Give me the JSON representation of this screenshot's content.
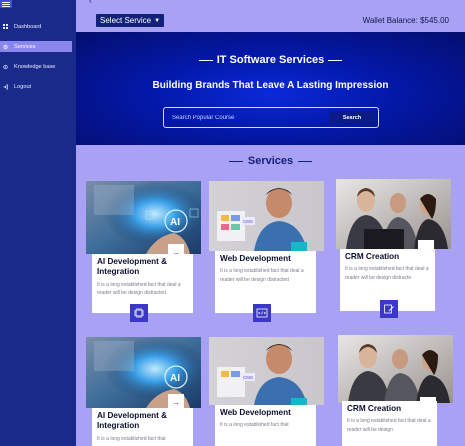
{
  "sidebar": {
    "items": [
      {
        "label": "Dashboard",
        "icon": "grid-icon"
      },
      {
        "label": "Services",
        "icon": "gear-icon",
        "active": true
      },
      {
        "label": "Knowledge base",
        "icon": "book-icon"
      },
      {
        "label": "Logout",
        "icon": "logout-icon"
      }
    ]
  },
  "topbar": {
    "select_label": "Select Service",
    "wallet_balance": "Wallet Balance: $545.00"
  },
  "hero": {
    "title": "IT Software Services",
    "subtitle": "Building Brands That Leave A Lasting Impression",
    "search_placeholder": "Search Popular Course",
    "search_button": "Search"
  },
  "services": {
    "heading": "Services",
    "cards": [
      {
        "title": "AI Development & Integration",
        "desc": "It is a long established fact that deal a reader will be design distracted"
      },
      {
        "title": "Web Development",
        "desc": "It is a long established fact that deal a reader will be design distracted"
      },
      {
        "title": "CRM Creation",
        "desc": "It is a long established fact that deal a reader will be design distracte"
      },
      {
        "title": "AI Development & Integration",
        "desc": "It is a long established fact that"
      },
      {
        "title": "Web Development",
        "desc": "It is a long established fact that"
      },
      {
        "title": "CRM Creation",
        "desc": "It is a long established fact that deal a reader will be design"
      }
    ]
  },
  "colors": {
    "sidebar": "#1a2a8a",
    "background": "#a9a2f4",
    "hero": "#0318a8",
    "accent": "#3b38c8",
    "teal": "#14b8c8"
  }
}
